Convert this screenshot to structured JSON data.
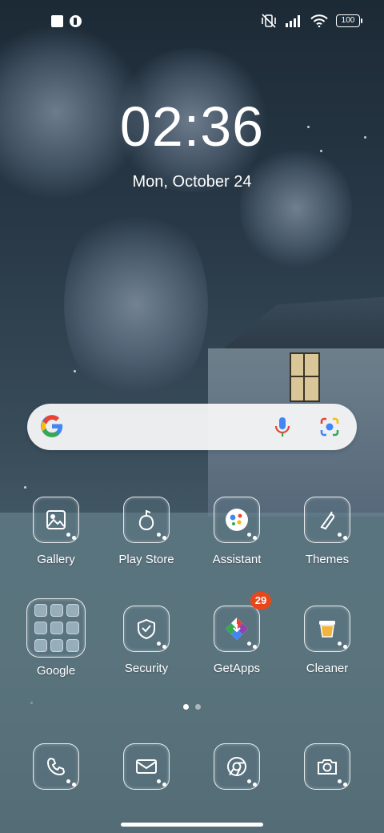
{
  "status_bar": {
    "left_icons": [
      "notification-square-icon",
      "notification-app-icon"
    ],
    "right_icons": [
      "vibrate-off-icon",
      "signal-icon",
      "wifi-icon"
    ],
    "battery": "100"
  },
  "lockscreen": {
    "time": "02:36",
    "date": "Mon, October 24"
  },
  "search": {
    "icons": [
      "google-g-icon",
      "mic-icon",
      "lens-icon"
    ]
  },
  "apps": {
    "row1": [
      {
        "label": "Gallery",
        "icon": "gallery-icon"
      },
      {
        "label": "Play Store",
        "icon": "play-store-icon"
      },
      {
        "label": "Assistant",
        "icon": "assistant-icon"
      },
      {
        "label": "Themes",
        "icon": "themes-icon"
      }
    ],
    "row2": [
      {
        "label": "Google",
        "icon": "google-folder-icon"
      },
      {
        "label": "Security",
        "icon": "security-icon"
      },
      {
        "label": "GetApps",
        "icon": "getapps-icon",
        "badge": "29"
      },
      {
        "label": "Cleaner",
        "icon": "cleaner-icon"
      }
    ]
  },
  "dock": [
    {
      "icon": "phone-icon"
    },
    {
      "icon": "messages-icon"
    },
    {
      "icon": "chrome-icon"
    },
    {
      "icon": "camera-icon"
    }
  ],
  "pager": {
    "pages": 2,
    "active": 1
  },
  "colors": {
    "badge": "#e8471b",
    "google_blue": "#4285F4",
    "google_red": "#EA4335",
    "google_yellow": "#FBBC05",
    "google_green": "#34A853"
  }
}
